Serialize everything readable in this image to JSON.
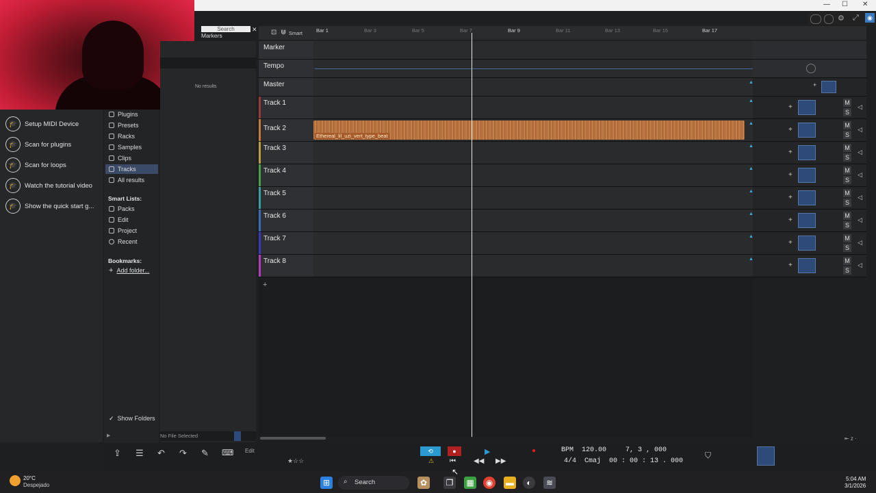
{
  "window": {
    "minimize": "—",
    "maximize": "☐",
    "close": "✕"
  },
  "browser": {
    "search_placeholder": "Search",
    "markers_label": "Markers",
    "no_results": "No results",
    "quickstart": [
      {
        "label": "Setup MIDI Device",
        "icon": "graduation-cap-icon"
      },
      {
        "label": "Scan for plugins",
        "icon": "graduation-cap-icon"
      },
      {
        "label": "Scan for loops",
        "icon": "graduation-cap-icon"
      },
      {
        "label": "Watch the tutorial video",
        "icon": "graduation-cap-icon"
      },
      {
        "label": "Show the quick start g...",
        "icon": "graduation-cap-icon"
      }
    ],
    "categories": [
      "Plugins",
      "Presets",
      "Racks",
      "Samples",
      "Clips",
      "Tracks",
      "All results"
    ],
    "selected_category": "Tracks",
    "smart_lists_heading": "Smart Lists:",
    "smart_lists": [
      "Packs",
      "Edit",
      "Project",
      "Recent"
    ],
    "bookmarks_heading": "Bookmarks:",
    "add_folder": "Add folder...",
    "show_folders": "Show Folders",
    "file_status": "No File Selected"
  },
  "ruler": {
    "smart_label": "Smart",
    "bars": [
      "Bar 1",
      "Bar 3",
      "Bar 5",
      "Bar 7",
      "Bar 9",
      "Bar 11",
      "Bar 13",
      "Bar 15",
      "Bar 17"
    ]
  },
  "tracks": [
    {
      "name": "Marker",
      "color": "#2f3033"
    },
    {
      "name": "Tempo",
      "color": "#2f3033"
    },
    {
      "name": "Master",
      "color": "#2f3033"
    },
    {
      "name": "Track 1",
      "color": "#9a3a3a"
    },
    {
      "name": "Track 2",
      "color": "#c97a3a",
      "clip": "Ethereal_lil_uzi_vert_type_beat"
    },
    {
      "name": "Track 3",
      "color": "#b8a03a"
    },
    {
      "name": "Track 4",
      "color": "#4aa04a"
    },
    {
      "name": "Track 5",
      "color": "#3aa0a0"
    },
    {
      "name": "Track 6",
      "color": "#3a6ab8"
    },
    {
      "name": "Track 7",
      "color": "#3a3ab8"
    },
    {
      "name": "Track 8",
      "color": "#b83ab8"
    }
  ],
  "mute_label": "M",
  "solo_label": "S",
  "add_track": "+",
  "edit_label": "Edit",
  "transport": {
    "bpm_label": "BPM",
    "bpm": "120.00",
    "position": "7, 3 , 000",
    "time_signature": "4/4",
    "key": "Cmaj",
    "timecode": "00 : 00 : 13 . 000"
  },
  "taskbar": {
    "temperature": "20°C",
    "weather": "Despejado",
    "search": "Search",
    "time": "5:04 AM",
    "date": "3/1/2026"
  }
}
